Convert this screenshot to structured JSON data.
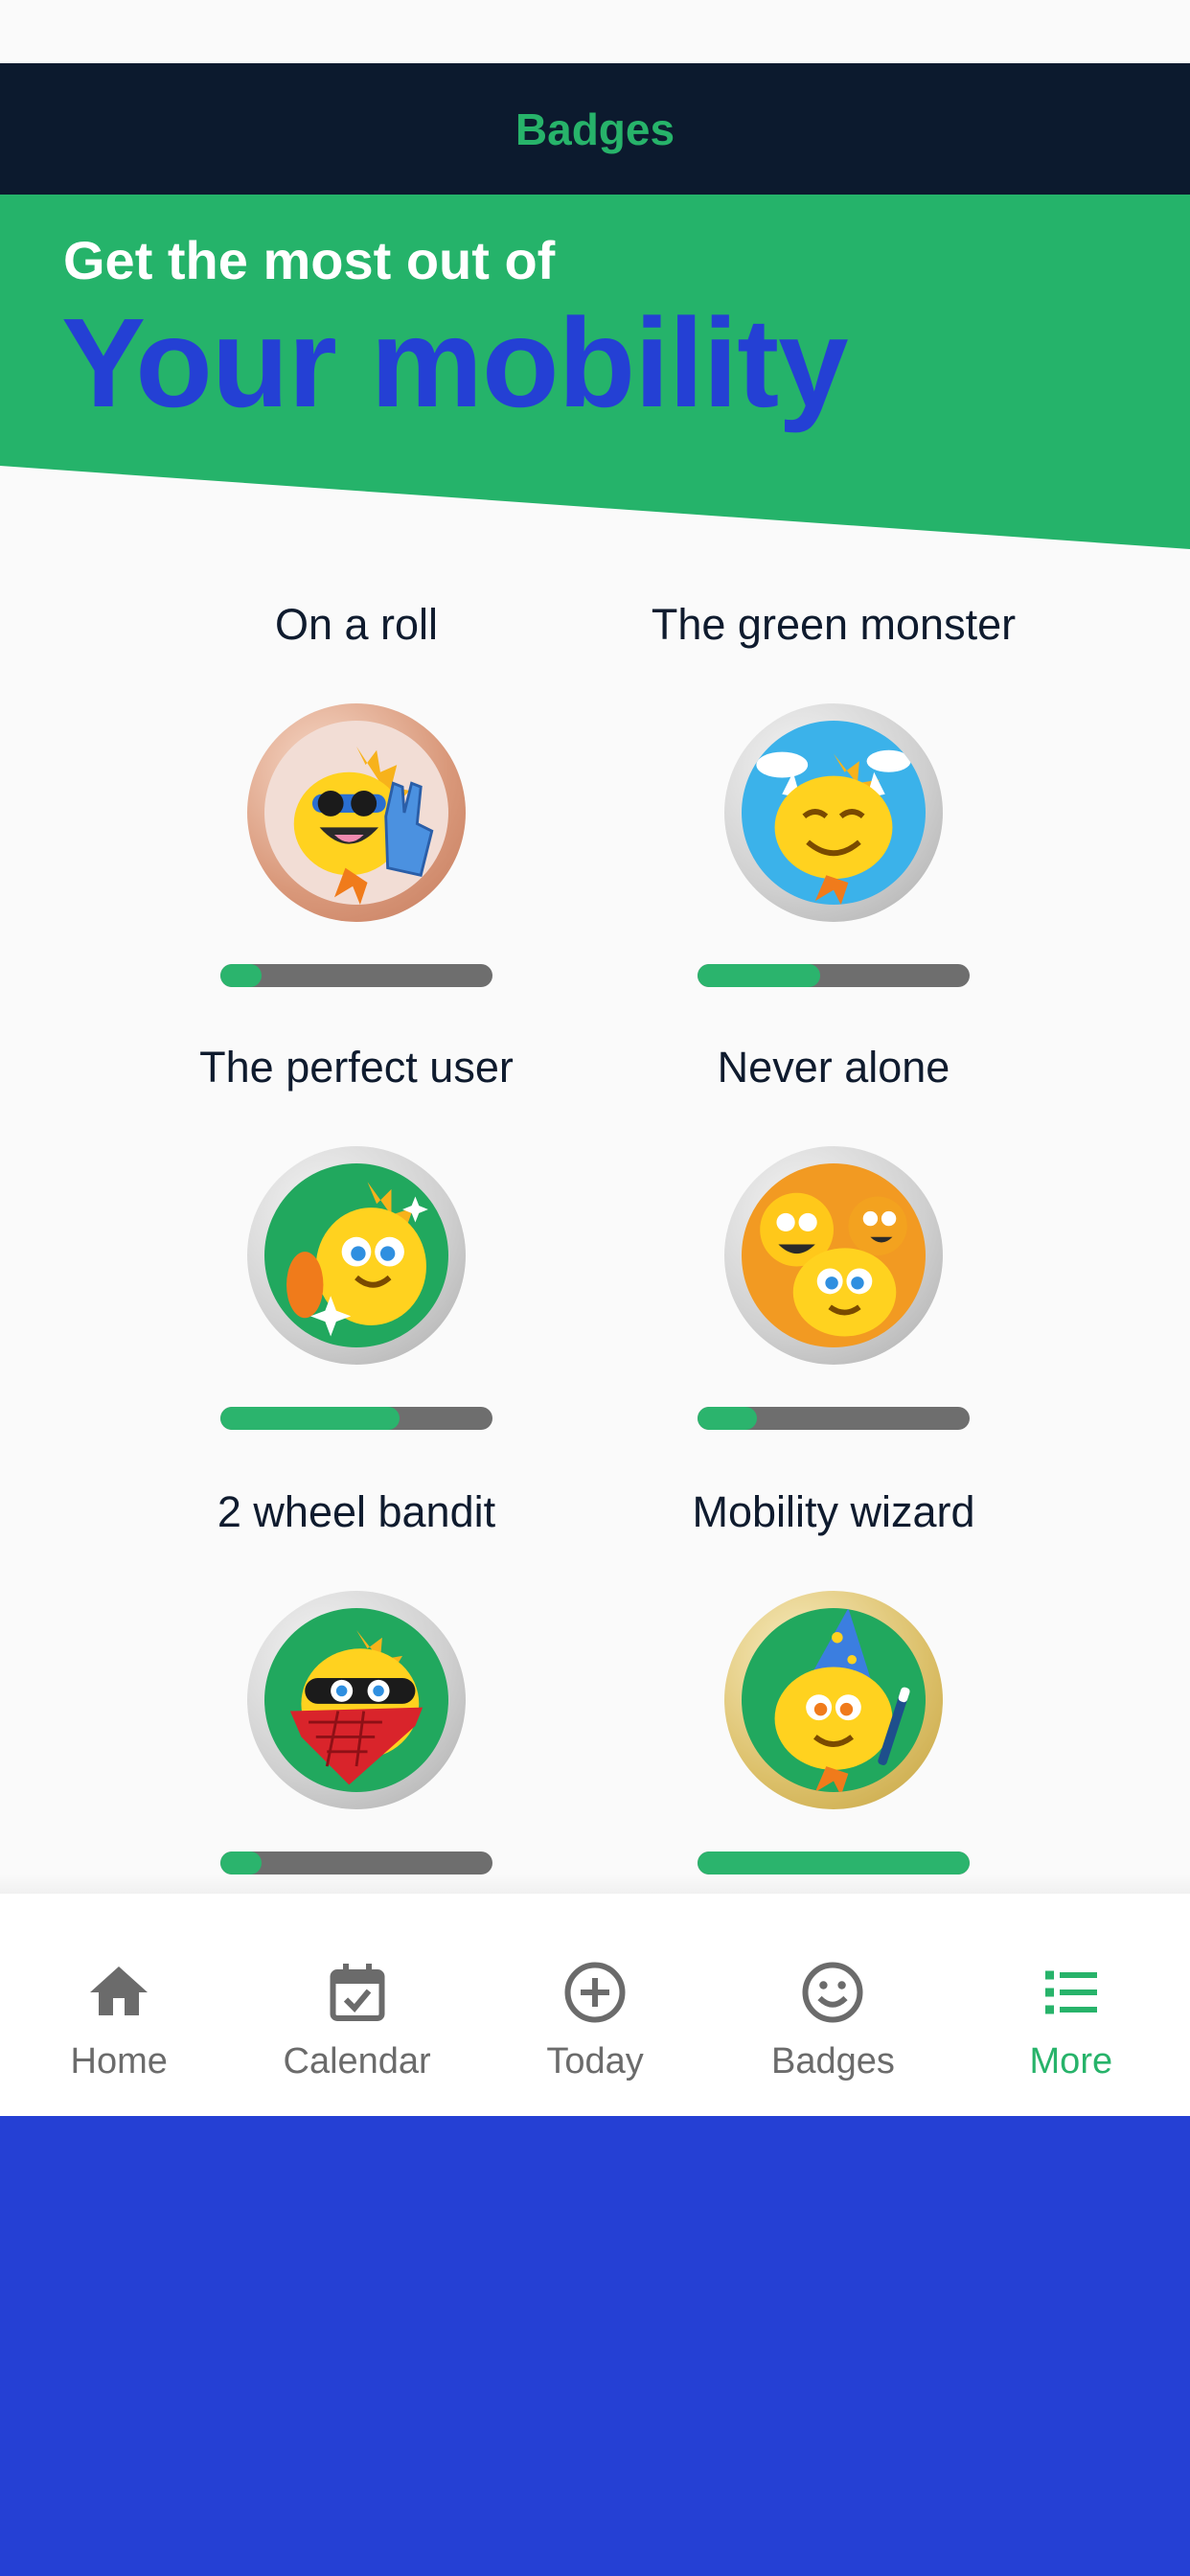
{
  "header": {
    "title": "Badges"
  },
  "hero": {
    "subtitle": "Get the most out of",
    "title": "Your mobility"
  },
  "badges": [
    {
      "name": "On a roll",
      "progress": 0.15,
      "rim": "bronze",
      "icon": "rocker-monster-badge"
    },
    {
      "name": "The green monster",
      "progress": 0.45,
      "rim": "silver",
      "icon": "smiling-monster-badge"
    },
    {
      "name": "The perfect user",
      "progress": 0.66,
      "rim": "silver",
      "icon": "sparkle-monster-badge"
    },
    {
      "name": "Never alone",
      "progress": 0.22,
      "rim": "silver",
      "icon": "group-monsters-badge"
    },
    {
      "name": "2 wheel bandit",
      "progress": 0.15,
      "rim": "silver",
      "icon": "bandit-monster-badge"
    },
    {
      "name": "Mobility wizard",
      "progress": 1.0,
      "rim": "gold",
      "icon": "wizard-monster-badge"
    }
  ],
  "tabs": [
    {
      "label": "Home",
      "icon": "home-icon",
      "active": false
    },
    {
      "label": "Calendar",
      "icon": "calendar-icon",
      "active": false
    },
    {
      "label": "Today",
      "icon": "plus-circle-icon",
      "active": false
    },
    {
      "label": "Badges",
      "icon": "smiley-icon",
      "active": false
    },
    {
      "label": "More",
      "icon": "list-icon",
      "active": true
    }
  ],
  "colors": {
    "navy": "#0c1a2e",
    "green": "#25b36a",
    "blue": "#2540d4",
    "progress_track": "#6e6e6e",
    "tab_inactive": "#6b6b6b"
  }
}
